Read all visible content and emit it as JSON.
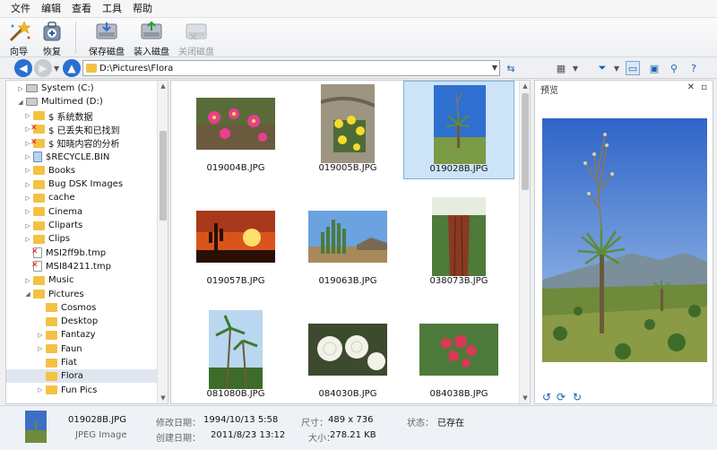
{
  "menu": [
    "文件",
    "编辑",
    "查看",
    "工具",
    "帮助"
  ],
  "toolbar": {
    "wizard": "向导",
    "restore": "恢复",
    "save_disk": "保存磁盘",
    "load_disk": "装入磁盘",
    "close_disk": "关闭磁盘"
  },
  "address": {
    "path": "D:\\Pictures\\Flora"
  },
  "tree": [
    {
      "label": "System (C:)",
      "indent": 1,
      "icon": "drive-icon",
      "twisty": "▷"
    },
    {
      "label": "Multimed (D:)",
      "indent": 1,
      "icon": "drive-icon",
      "twisty": "◢"
    },
    {
      "label": "$ 系统数据",
      "indent": 2,
      "icon": "folder-icon",
      "twisty": "▷"
    },
    {
      "label": "$ 已丢失和已找到",
      "indent": 2,
      "icon": "deleted-folder-icon",
      "twisty": "▷"
    },
    {
      "label": "$ 知晓内容的分析",
      "indent": 2,
      "icon": "deleted-folder-icon",
      "twisty": "▷"
    },
    {
      "label": "$RECYCLE.BIN",
      "indent": 2,
      "icon": "recycle-bin-icon",
      "twisty": "▷"
    },
    {
      "label": "Books",
      "indent": 2,
      "icon": "folder-icon",
      "twisty": "▷"
    },
    {
      "label": "Bug DSK Images",
      "indent": 2,
      "icon": "folder-icon",
      "twisty": "▷"
    },
    {
      "label": "cache",
      "indent": 2,
      "icon": "folder-icon",
      "twisty": "▷"
    },
    {
      "label": "Cinema",
      "indent": 2,
      "icon": "folder-icon",
      "twisty": "▷"
    },
    {
      "label": "Cliparts",
      "indent": 2,
      "icon": "folder-icon",
      "twisty": "▷"
    },
    {
      "label": "Clips",
      "indent": 2,
      "icon": "folder-icon",
      "twisty": "▷"
    },
    {
      "label": "MSI2ff9b.tmp",
      "indent": 2,
      "icon": "deleted-file-icon",
      "twisty": ""
    },
    {
      "label": "MSI84211.tmp",
      "indent": 2,
      "icon": "deleted-file-icon",
      "twisty": ""
    },
    {
      "label": "Music",
      "indent": 2,
      "icon": "folder-icon",
      "twisty": "▷"
    },
    {
      "label": "Pictures",
      "indent": 2,
      "icon": "folder-icon",
      "twisty": "◢"
    },
    {
      "label": "Cosmos",
      "indent": 3,
      "icon": "folder-icon",
      "twisty": ""
    },
    {
      "label": "Desktop",
      "indent": 3,
      "icon": "folder-icon",
      "twisty": ""
    },
    {
      "label": "Fantazy",
      "indent": 3,
      "icon": "folder-icon",
      "twisty": "▷"
    },
    {
      "label": "Faun",
      "indent": 3,
      "icon": "folder-icon",
      "twisty": "▷"
    },
    {
      "label": "Fiat",
      "indent": 3,
      "icon": "folder-icon",
      "twisty": ""
    },
    {
      "label": "Flora",
      "indent": 3,
      "icon": "folder-icon",
      "twisty": "",
      "selected": true
    },
    {
      "label": "Fun Pics",
      "indent": 3,
      "icon": "folder-icon",
      "twisty": "▷"
    }
  ],
  "files": [
    {
      "name": "019004B.JPG",
      "thumb": "cactus-pink-flowers-thumbnail"
    },
    {
      "name": "019005B.JPG",
      "thumb": "cactus-yellow-flowers-thumbnail"
    },
    {
      "name": "019028B.JPG",
      "thumb": "yucca-plant-thumbnail",
      "selected": true
    },
    {
      "name": "019057B.JPG",
      "thumb": "desert-sunset-thumbnail"
    },
    {
      "name": "019063B.JPG",
      "thumb": "organ-pipe-cactus-thumbnail"
    },
    {
      "name": "038073B.JPG",
      "thumb": "redwood-tree-thumbnail"
    },
    {
      "name": "081080B.JPG",
      "thumb": "palm-trees-thumbnail"
    },
    {
      "name": "084030B.JPG",
      "thumb": "white-roses-thumbnail"
    },
    {
      "name": "084038B.JPG",
      "thumb": "red-roses-thumbnail"
    }
  ],
  "preview": {
    "title": "预览"
  },
  "status": {
    "file_name": "019028B.JPG",
    "file_type": "JPEG Image",
    "modified_label": "修改日期：",
    "modified_value": "1994/10/13 5:58",
    "created_label": "创建日期：",
    "created_value": "2011/8/23 13:12",
    "dims_label": "尺寸：",
    "dims_value": "489 x 736",
    "size_label": "大小：",
    "size_value": "278.21 KB",
    "state_label": "状态：",
    "state_value": "已存在"
  },
  "colors": {
    "folder": "#f3c244",
    "selection": "#cde3f7",
    "accent": "#1a5fb4"
  }
}
